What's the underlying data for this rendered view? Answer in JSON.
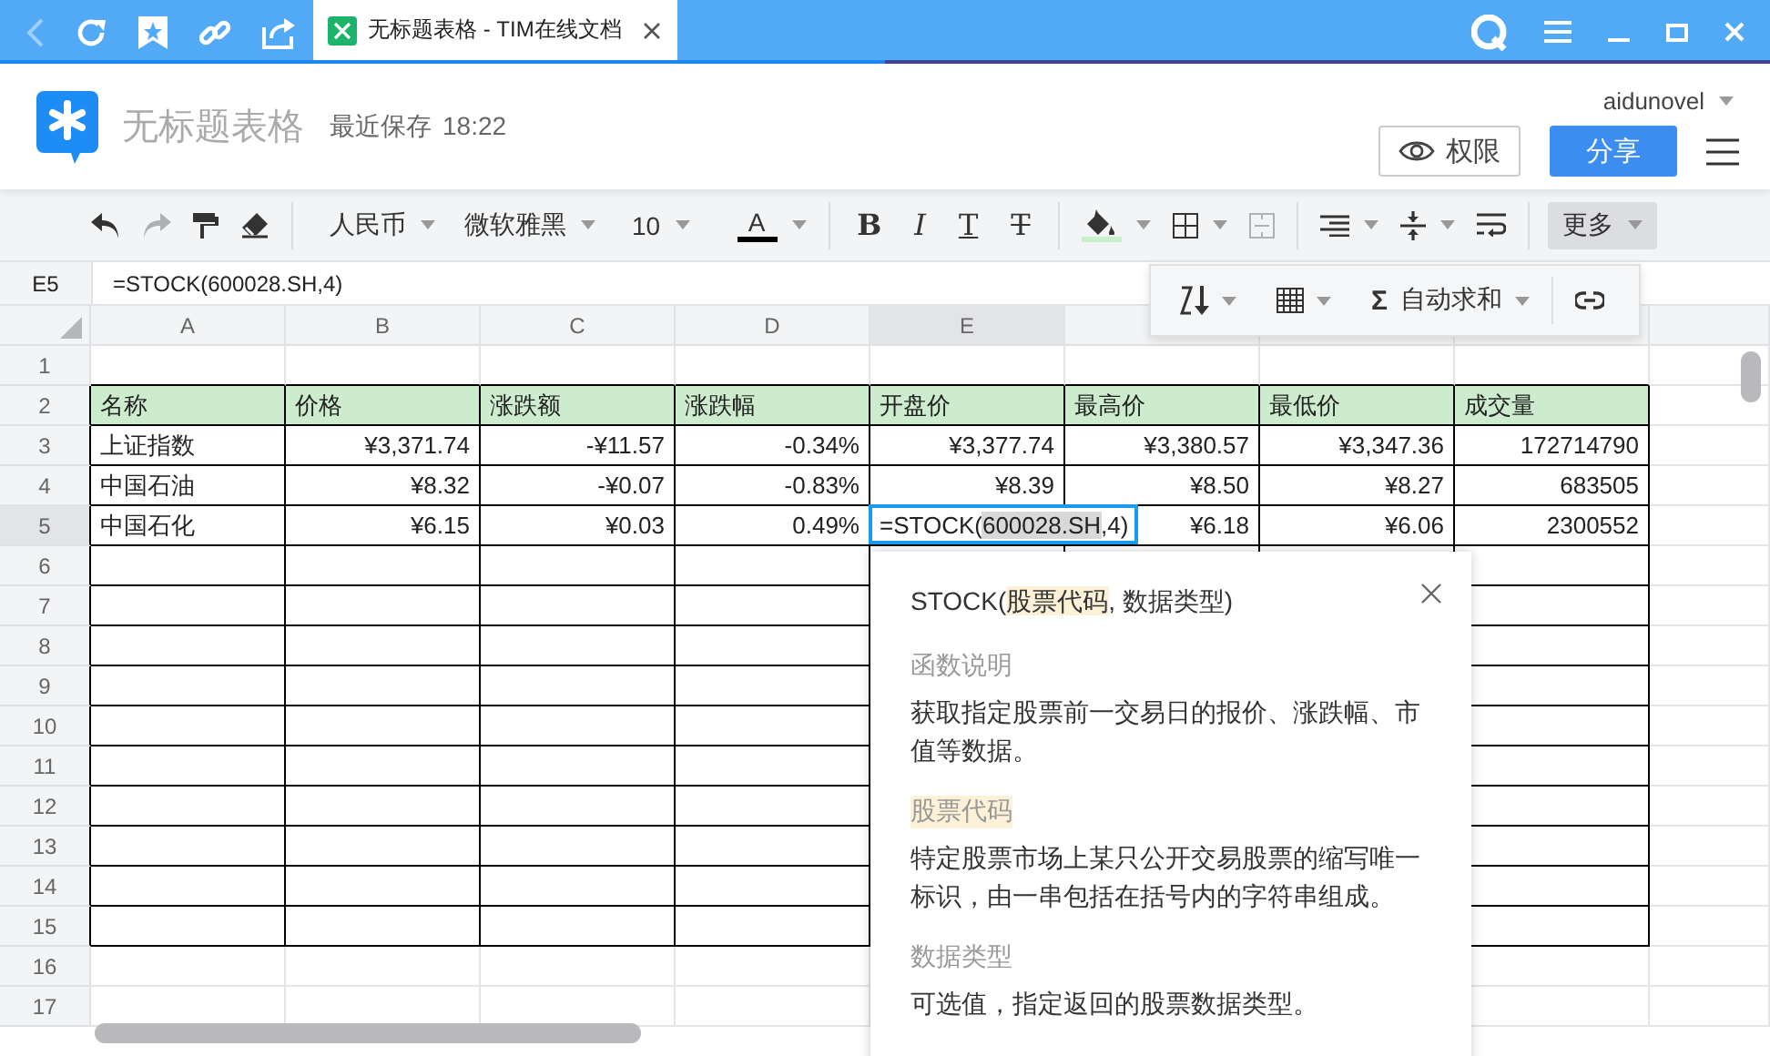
{
  "browser": {
    "back_disabled": true,
    "tab_title": "无标题表格 - TIM在线文档",
    "tab_selected": true
  },
  "header": {
    "doc_title": "无标题表格",
    "save_status": "最近保存",
    "save_time": "18:22",
    "user": "aidunovel",
    "permission_button": "权限",
    "share_button": "分享"
  },
  "toolbar": {
    "undo_disabled": false,
    "redo_disabled": true,
    "currency": "人民币",
    "font": "微软雅黑",
    "size": "10",
    "font_color_label": "A",
    "bold": "B",
    "italic": "I",
    "underline": "T",
    "strikethrough": "T",
    "merge_disabled": true,
    "more": {
      "label": "更多",
      "expanded": true
    }
  },
  "more_menu": {
    "sum_symbol": "Σ",
    "sum_label": "自动求和"
  },
  "formula_bar": {
    "cell_ref": "E5",
    "formula": "=STOCK(600028.SH,4)"
  },
  "columns": [
    {
      "label": "A",
      "selected": false
    },
    {
      "label": "B",
      "selected": false
    },
    {
      "label": "C",
      "selected": false
    },
    {
      "label": "D",
      "selected": false
    },
    {
      "label": "E",
      "selected": true
    }
  ],
  "rows": [
    {
      "number": "1",
      "selected": false,
      "bordered": false
    },
    {
      "number": "2",
      "selected": false,
      "bordered": true,
      "kind": "header",
      "cells": [
        "名称",
        "价格",
        "涨跌额",
        "涨跌幅",
        "开盘价",
        "最高价",
        "最低价",
        "成交量"
      ]
    },
    {
      "number": "3",
      "selected": false,
      "bordered": true,
      "kind": "data",
      "cells": [
        "上证指数",
        "¥3,371.74",
        "-¥11.57",
        "-0.34%",
        "¥3,377.74",
        "¥3,380.57",
        "¥3,347.36",
        "172714790"
      ]
    },
    {
      "number": "4",
      "selected": false,
      "bordered": true,
      "kind": "data",
      "cells": [
        "中国石油",
        "¥8.32",
        "-¥0.07",
        "-0.83%",
        "¥8.39",
        "¥8.50",
        "¥8.27",
        "683505"
      ]
    },
    {
      "number": "5",
      "selected": true,
      "bordered": true,
      "kind": "data",
      "cells": [
        "中国石化",
        "¥6.15",
        "¥0.03",
        "0.49%",
        {
          "kind": "editor",
          "parts": [
            "=STOCK(",
            "600028.SH",
            ",4)"
          ]
        },
        "¥6.18",
        "¥6.06",
        "2300552"
      ]
    },
    {
      "number": "6",
      "selected": false,
      "bordered": true
    },
    {
      "number": "7",
      "selected": false,
      "bordered": true
    },
    {
      "number": "8",
      "selected": false,
      "bordered": true
    },
    {
      "number": "9",
      "selected": false,
      "bordered": true
    },
    {
      "number": "10",
      "selected": false,
      "bordered": true
    },
    {
      "number": "11",
      "selected": false,
      "bordered": true
    },
    {
      "number": "12",
      "selected": false,
      "bordered": true
    },
    {
      "number": "13",
      "selected": false,
      "bordered": true
    },
    {
      "number": "14",
      "selected": false,
      "bordered": true
    },
    {
      "number": "15",
      "selected": false,
      "bordered": true
    },
    {
      "number": "16",
      "selected": false,
      "bordered": false
    },
    {
      "number": "17",
      "selected": false,
      "bordered": false
    }
  ],
  "function_help": {
    "signature": [
      "STOCK(",
      "股票代码",
      ", 数据类型)"
    ],
    "sections": [
      {
        "heading": "函数说明",
        "highlighted": false,
        "text": "获取指定股票前一交易日的报价、涨跌幅、市值等数据。"
      },
      {
        "heading": "股票代码",
        "highlighted": true,
        "text": "特定股票市场上某只公开交易股票的缩写唯一标识，由一串包括在括号内的字符串组成。"
      },
      {
        "heading": "数据类型",
        "highlighted": false,
        "text": "可选值，指定返回的股票数据类型。"
      }
    ]
  }
}
